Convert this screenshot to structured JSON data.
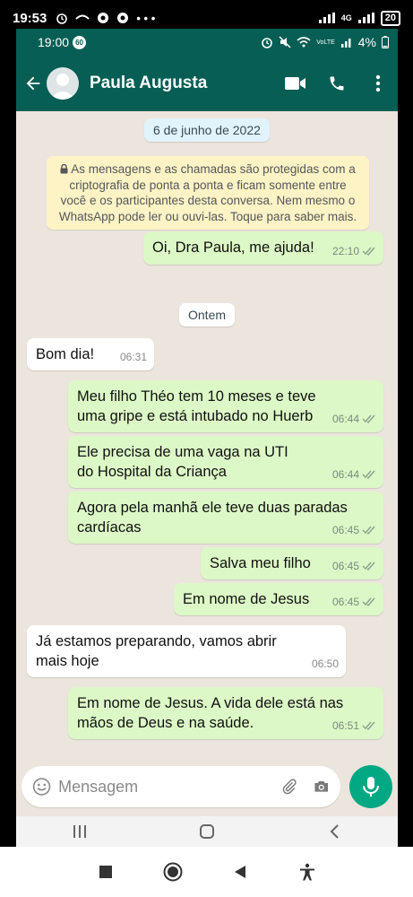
{
  "outer_status": {
    "time": "19:53",
    "battery": "20",
    "net": "4G"
  },
  "inner_status": {
    "time": "19:00",
    "badge": "60",
    "battery_pct": "4%",
    "volte": "VoLTE"
  },
  "header": {
    "contact_name": "Paula Augusta"
  },
  "chat": {
    "date_chip_1": "6 de junho de 2022",
    "encryption_notice": "As mensagens e as chamadas são protegidas com a criptografia de ponta a ponta e ficam somente entre você e os participantes desta conversa. Nem mesmo o WhatsApp pode ler ou ouvi-las. Toque para saber mais.",
    "date_chip_2": "Ontem",
    "messages": [
      {
        "text": "Oi, Dra Paula, me ajuda!",
        "time": "22:10",
        "dir": "out"
      },
      {
        "text": "Bom dia!",
        "time": "06:31",
        "dir": "in"
      },
      {
        "text": "Meu filho Théo tem 10 meses e teve uma gripe e está intubado no Huerb",
        "time": "06:44",
        "dir": "out"
      },
      {
        "text": "Ele precisa de uma vaga na UTI do Hospital da Criança",
        "time": "06:44",
        "dir": "out"
      },
      {
        "text": "Agora pela manhã ele teve duas paradas cardíacas",
        "time": "06:45",
        "dir": "out"
      },
      {
        "text": "Salva meu filho",
        "time": "06:45",
        "dir": "out"
      },
      {
        "text": "Em nome de Jesus",
        "time": "06:45",
        "dir": "out"
      },
      {
        "text": "Já estamos preparando, vamos abrir mais hoje",
        "time": "06:50",
        "dir": "in"
      },
      {
        "text": "Em nome de Jesus. A vida dele está nas mãos de Deus e na saúde.",
        "time": "06:51",
        "dir": "out"
      }
    ]
  },
  "composer": {
    "placeholder": "Mensagem"
  },
  "colors": {
    "header": "#075e54",
    "outgoing": "#dcf8c6",
    "incoming": "#ffffff",
    "wallpaper": "#ece5dd",
    "accent": "#00a884"
  },
  "icons": [
    "back-arrow-icon",
    "video-call-icon",
    "phone-icon",
    "more-vert-icon",
    "lock-icon",
    "emoji-icon",
    "attach-icon",
    "camera-icon",
    "mic-icon"
  ]
}
